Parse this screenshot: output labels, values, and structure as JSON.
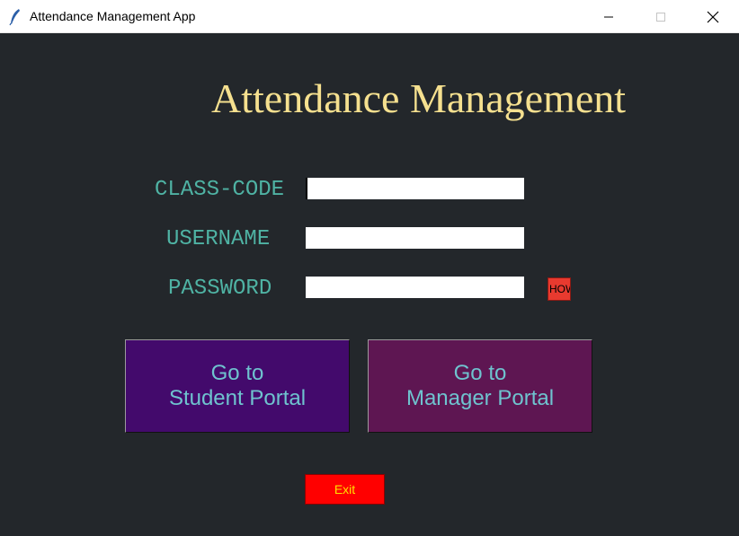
{
  "window": {
    "title": "Attendance Management App",
    "icon": "feather-icon",
    "controls": [
      "minimize-icon",
      "maximize-icon",
      "close-icon"
    ]
  },
  "main": {
    "heading": "Attendance Management",
    "fields": {
      "class_code": {
        "label": "CLASS-CODE",
        "value": "",
        "placeholder": ""
      },
      "username": {
        "label": "USERNAME",
        "value": "",
        "placeholder": ""
      },
      "password": {
        "label": "PASSWORD",
        "value": "",
        "placeholder": ""
      }
    },
    "show_button": {
      "label": "HOW"
    },
    "student_portal": {
      "line1": "Go to",
      "line2": "Student Portal"
    },
    "manager_portal": {
      "line1": "Go to",
      "line2": "Manager Portal"
    },
    "exit_button": {
      "label": "Exit"
    }
  },
  "colors": {
    "background": "#23272b",
    "heading": "#f5e08f",
    "label": "#4fb3a4",
    "student_button": "#430a6c",
    "manager_button": "#5e1652",
    "portal_text": "#6fc3cf",
    "exit_button": "#ff0000",
    "exit_text": "#ffe000",
    "show_button": "#e83a2f"
  }
}
